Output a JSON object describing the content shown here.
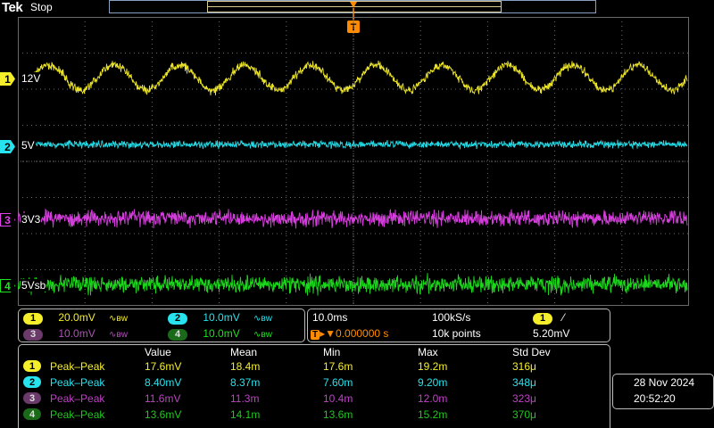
{
  "header": {
    "brand": "Tek",
    "state": "Stop",
    "trigger_marker": "T"
  },
  "colors": {
    "ch1": "#f5ee2a",
    "ch2": "#26e3ee",
    "ch3": "#e040e8",
    "ch4": "#1ee21e",
    "grid": "#6a6a6a"
  },
  "channels": [
    {
      "num": "1",
      "label": "12V"
    },
    {
      "num": "2",
      "label": "5V"
    },
    {
      "num": "3",
      "label": "3V3"
    },
    {
      "num": "4",
      "label": "5Vsb"
    }
  ],
  "vertical": [
    {
      "num": "1",
      "scale": "20.0mV"
    },
    {
      "num": "2",
      "scale": "10.0mV"
    },
    {
      "num": "3",
      "scale": "10.0mV"
    },
    {
      "num": "4",
      "scale": "10.0mV"
    }
  ],
  "bw_symbol": "∿ʙᴡ",
  "horizontal": {
    "time_div": "10.0ms",
    "sample_rate": "100kS/s",
    "delay": "0.000000 s",
    "record": "10k points",
    "trigger_prefix": "T"
  },
  "trigger": {
    "source": "1",
    "slope": "⁄",
    "level": "5.20mV"
  },
  "measurements": {
    "headers": [
      "Value",
      "Mean",
      "Min",
      "Max",
      "Std Dev"
    ],
    "rows": [
      {
        "num": "1",
        "type": "Peak–Peak",
        "value": "17.6mV",
        "mean": "18.4m",
        "min": "17.6m",
        "max": "19.2m",
        "std": "316μ"
      },
      {
        "num": "2",
        "type": "Peak–Peak",
        "value": "8.40mV",
        "mean": "8.37m",
        "min": "7.60m",
        "max": "9.20m",
        "std": "348μ"
      },
      {
        "num": "3",
        "type": "Peak–Peak",
        "value": "11.6mV",
        "mean": "11.3m",
        "min": "10.4m",
        "max": "12.0m",
        "std": "323μ"
      },
      {
        "num": "4",
        "type": "Peak–Peak",
        "value": "13.6mV",
        "mean": "14.1m",
        "min": "13.6m",
        "max": "15.2m",
        "std": "370μ"
      }
    ]
  },
  "datetime": {
    "date": "28 Nov 2024",
    "time": "20:52:20"
  }
}
